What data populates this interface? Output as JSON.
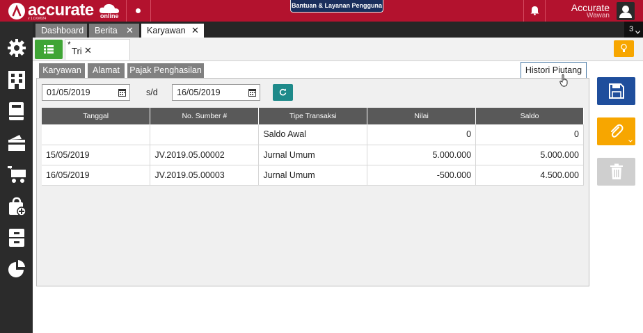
{
  "app": {
    "logo_text": "accurate",
    "logo_suffix": "online",
    "version": "v 1.0.0#024",
    "help_button": "Bantuan & Layanan Pengguna",
    "user_name": "Accurate",
    "user_sub": "Wawan",
    "brand_color": "#b3122e"
  },
  "sidebar": {
    "icons": [
      "gear-icon",
      "building-icon",
      "book-icon",
      "wallet-icon",
      "cart-icon",
      "bag-add-icon",
      "archive-icon",
      "pie-chart-icon"
    ]
  },
  "tabs": [
    {
      "label": "Dashboard",
      "closable": false,
      "active": false
    },
    {
      "label": "Berita",
      "closable": true,
      "active": false
    },
    {
      "label": "Karyawan",
      "closable": true,
      "active": true
    }
  ],
  "tab_count": "3",
  "document": {
    "modified_mark": "*",
    "name": "Tri"
  },
  "panel_tabs": [
    "Karyawan",
    "Alamat",
    "Pajak Penghasilan",
    "Histori Piutang"
  ],
  "active_panel_tab": "Histori Piutang",
  "filter": {
    "date_from": "01/05/2019",
    "separator": "s/d",
    "date_to": "16/05/2019"
  },
  "table": {
    "columns": [
      "Tanggal",
      "No. Sumber #",
      "Tipe Transaksi",
      "Nilai",
      "Saldo"
    ],
    "rows": [
      {
        "tanggal": "",
        "no_sumber": "",
        "tipe": "Saldo Awal",
        "nilai": "0",
        "saldo": "0"
      },
      {
        "tanggal": "15/05/2019",
        "no_sumber": "JV.2019.05.00002",
        "tipe": "Jurnal Umum",
        "nilai": "5.000.000",
        "saldo": "5.000.000"
      },
      {
        "tanggal": "16/05/2019",
        "no_sumber": "JV.2019.05.00003",
        "tipe": "Jurnal Umum",
        "nilai": "-500.000",
        "saldo": "4.500.000"
      }
    ]
  },
  "actions": {
    "save": "save-icon",
    "attach": "paperclip-icon",
    "delete": "trash-icon"
  }
}
